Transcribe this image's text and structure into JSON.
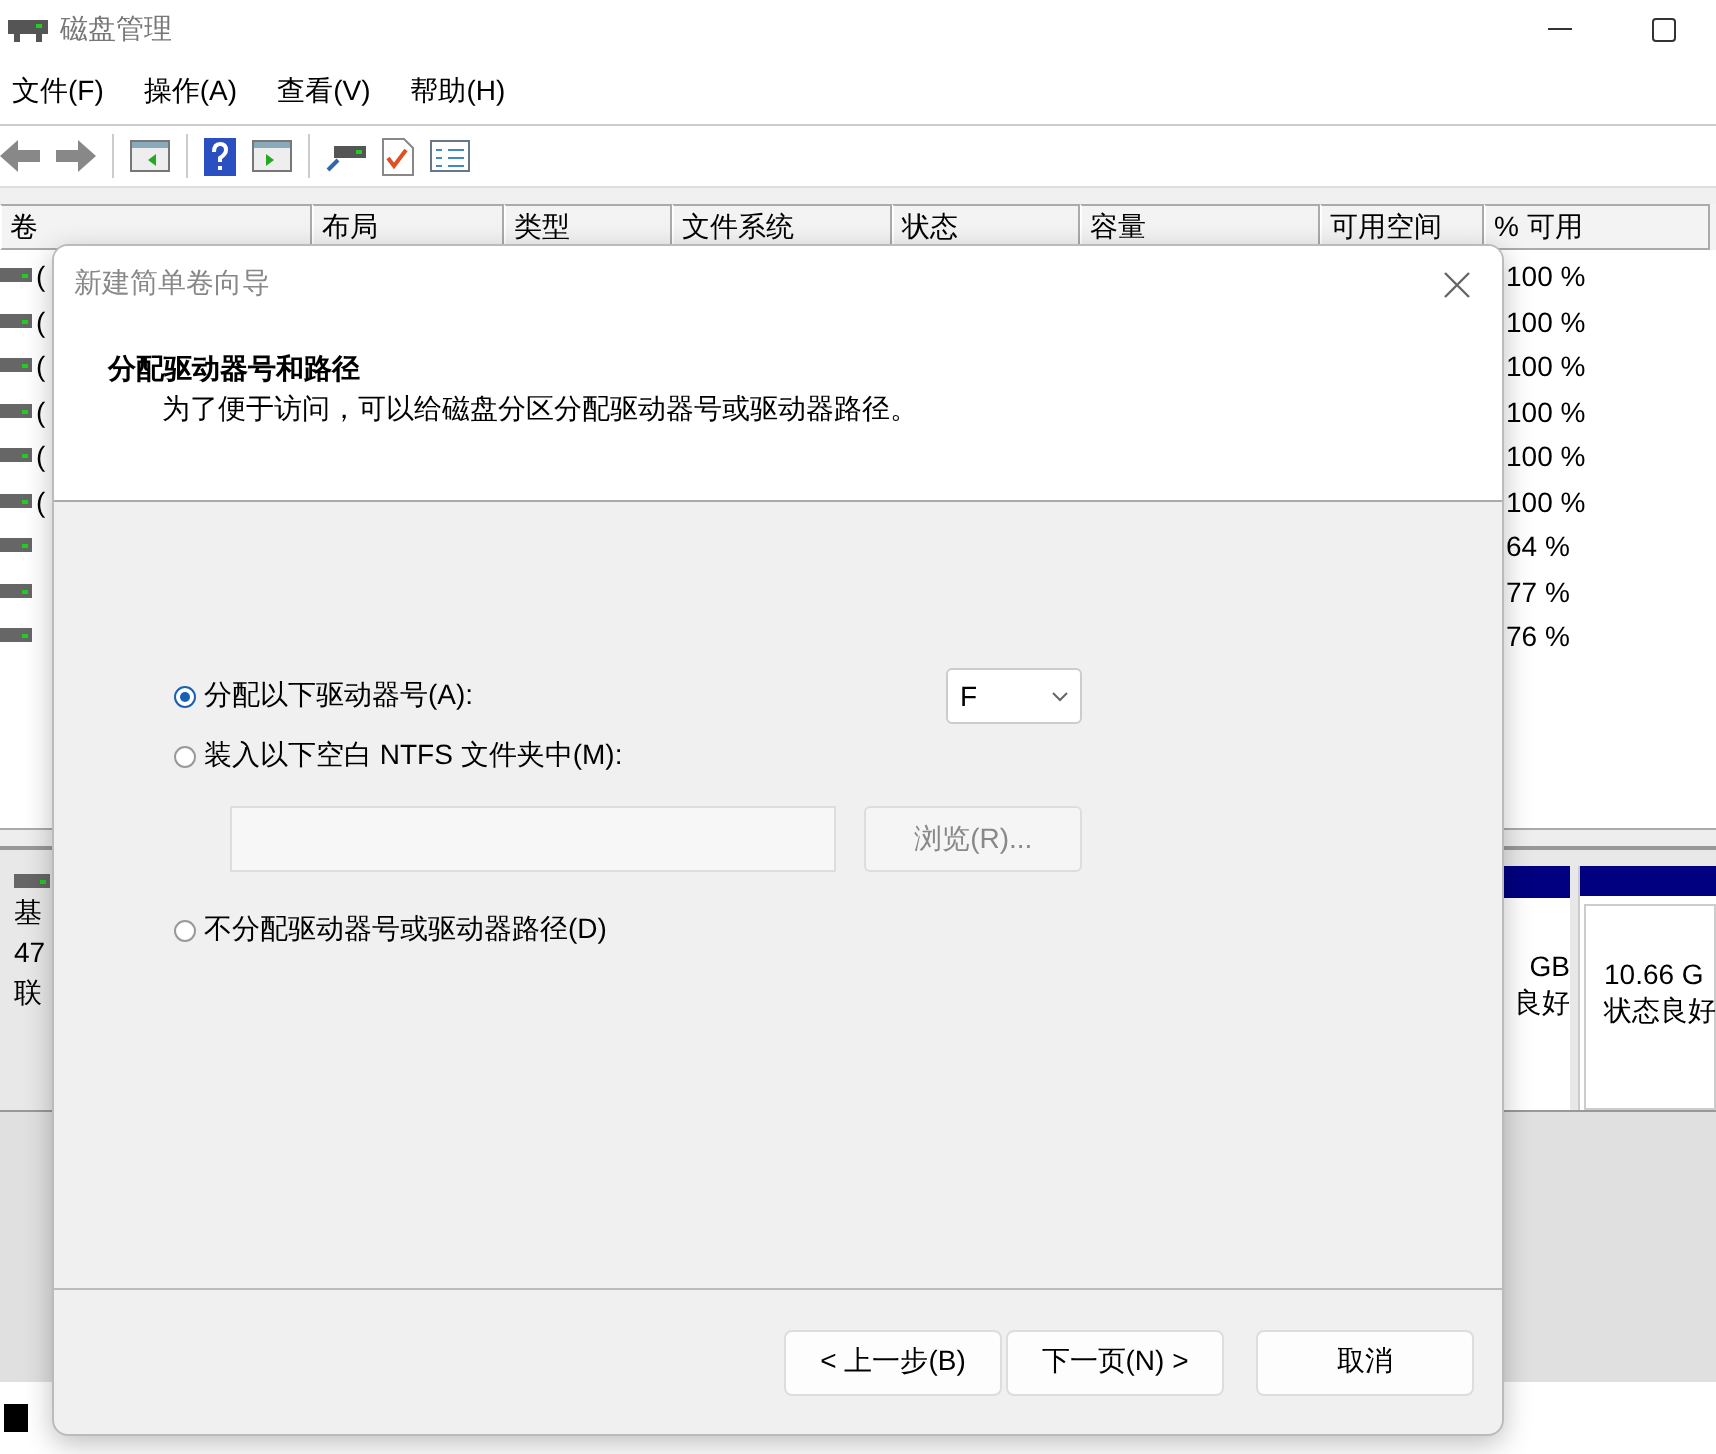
{
  "window": {
    "title": "磁盘管理"
  },
  "menu": [
    "文件(F)",
    "操作(A)",
    "查看(V)",
    "帮助(H)"
  ],
  "volume_table": {
    "columns": [
      "卷",
      "布局",
      "类型",
      "文件系统",
      "状态",
      "容量",
      "可用空间",
      "% 可用"
    ],
    "rows": [
      {
        "volume": "(",
        "percent_free": "100 %"
      },
      {
        "volume": "(",
        "percent_free": "100 %"
      },
      {
        "volume": "(",
        "percent_free": "100 %"
      },
      {
        "volume": "(",
        "percent_free": "100 %"
      },
      {
        "volume": "(",
        "percent_free": "100 %"
      },
      {
        "volume": "(",
        "percent_free": "100 %"
      },
      {
        "percent_free": "64 %"
      },
      {
        "percent_free": "77 %"
      },
      {
        "percent_free": "76 %"
      }
    ]
  },
  "disk_pane": {
    "disk_lines": [
      "基",
      "47",
      "联"
    ],
    "partitions": [
      {
        "lines": [
          "GB",
          "良好"
        ]
      },
      {
        "lines": [
          "10.66 G",
          "状态良好"
        ]
      }
    ]
  },
  "dialog": {
    "title": "新建简单卷向导",
    "heading": "分配驱动器号和路径",
    "description": "为了便于访问，可以给磁盘分区分配驱动器号或驱动器路径。",
    "options": [
      {
        "kind": "drive-letter",
        "label": "分配以下驱动器号(A):",
        "selected": true,
        "value": "F"
      },
      {
        "kind": "folder",
        "label": "装入以下空白 NTFS 文件夹中(M):",
        "selected": false,
        "button": "浏览(R)...",
        "disabled": true
      },
      {
        "kind": "none",
        "label": "不分配驱动器号或驱动器路径(D)",
        "selected": false
      }
    ],
    "buttons": [
      "< 上一步(B)",
      "下一页(N) >",
      "取消"
    ]
  }
}
